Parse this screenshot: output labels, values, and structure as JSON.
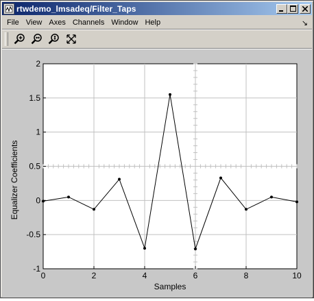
{
  "window": {
    "title": "rtwdemo_lmsadeq/Filter_Taps",
    "minimize_label": "_",
    "maximize_label": "□",
    "close_label": "✕"
  },
  "menu": {
    "items": [
      "File",
      "View",
      "Axes",
      "Channels",
      "Window",
      "Help"
    ],
    "dock_arrow": "↘"
  },
  "toolbar": {
    "tools": [
      {
        "name": "zoom-in-icon"
      },
      {
        "name": "zoom-x-icon"
      },
      {
        "name": "zoom-y-icon"
      },
      {
        "name": "autoscale-icon"
      }
    ]
  },
  "colors": {
    "plot_background": "#c8c8c8",
    "axes_background": "#ffffff",
    "grid": "#c0c0c0",
    "line": "#000000"
  },
  "chart_data": {
    "type": "line",
    "title": "",
    "xlabel": "Samples",
    "ylabel": "Equalizer Coefficients",
    "xlim": [
      0,
      10
    ],
    "ylim": [
      -1,
      2
    ],
    "xticks": [
      0,
      2,
      4,
      6,
      8,
      10
    ],
    "yticks": [
      -1,
      -0.5,
      0,
      0.5,
      1,
      1.5,
      2
    ],
    "yticklabels": [
      "-1",
      "-0.5",
      "0",
      "0.5",
      "1",
      "1.5",
      "2"
    ],
    "grid": true,
    "markers": true,
    "series": [
      {
        "x": [
          0,
          1,
          2,
          3,
          4,
          5,
          6,
          7,
          8,
          9,
          10
        ],
        "values": [
          -0.01,
          0.05,
          -0.13,
          0.31,
          -0.7,
          1.55,
          -0.71,
          0.33,
          -0.13,
          0.05,
          -0.02
        ]
      }
    ]
  }
}
